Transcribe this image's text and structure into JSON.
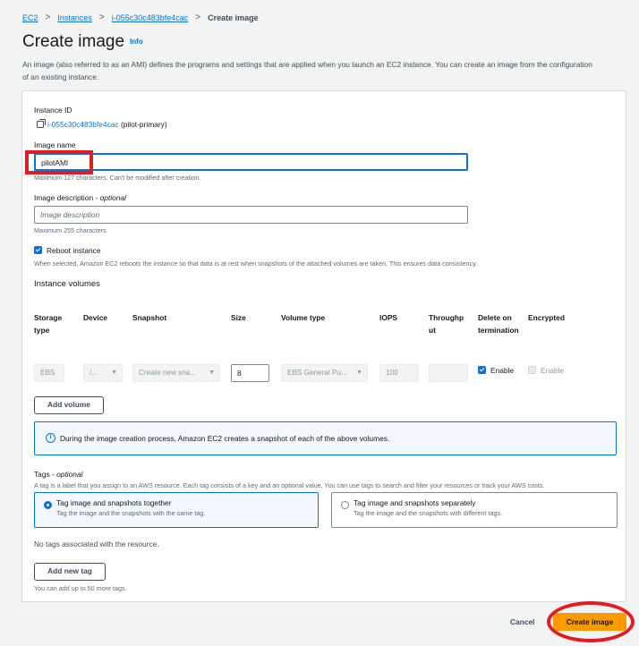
{
  "breadcrumb": {
    "items": [
      "EC2",
      "Instances",
      "i-055c30c483bfe4cac"
    ],
    "current": "Create image",
    "separator": ">"
  },
  "header": {
    "title": "Create image",
    "info_link": "Info",
    "description": "An image (also referred to as an AMI) defines the programs and settings that are applied when you launch an EC2 instance. You can create an image from the configuration of an existing instance."
  },
  "instance": {
    "label": "Instance ID",
    "id": "i-055c30c483bfe4cac",
    "name": "(pilot-primary)"
  },
  "image_name": {
    "label": "Image name",
    "value": "pilotAMI",
    "hint": "Maximum 127 characters. Can't be modified after creation."
  },
  "image_description": {
    "label": "Image description - ",
    "label_optional": "optional",
    "placeholder": "Image description",
    "hint": "Maximum 255 characters"
  },
  "reboot": {
    "label": "Reboot instance",
    "checked": true,
    "hint": "When selected, Amazon EC2 reboots the instance so that data is at rest when snapshots of the attached volumes are taken. This ensures data consistency."
  },
  "volumes": {
    "title": "Instance volumes",
    "headers": {
      "storage_type": "Storage type",
      "device": "Device",
      "snapshot": "Snapshot",
      "size": "Size",
      "volume_type": "Volume type",
      "iops": "IOPS",
      "throughput": "Throughput",
      "delete_on_termination": "Delete on termination",
      "encrypted": "Encrypted"
    },
    "row": {
      "storage_type": "EBS",
      "device": "/...",
      "snapshot": "Create new sna...",
      "size": "8",
      "volume_type": "EBS General Pu...",
      "iops": "100",
      "throughput": "",
      "delete_label": "Enable",
      "encrypted_label": "Enable"
    },
    "add_button": "Add volume",
    "info": "During the image creation process, Amazon EC2 creates a snapshot of each of the above volumes."
  },
  "tags": {
    "title": "Tags - ",
    "title_optional": "optional",
    "description": "A tag is a label that you assign to an AWS resource. Each tag consists of a key and an optional value. You can use tags to search and filter your resources or track your AWS costs.",
    "option_together": {
      "title": "Tag image and snapshots together",
      "desc": "Tag the image and the snapshots with the same tag.",
      "selected": true
    },
    "option_separately": {
      "title": "Tag image and snapshots separately",
      "desc": "Tag the image and the snapshots with different tags.",
      "selected": false
    },
    "empty": "No tags associated with the resource.",
    "add_button": "Add new tag",
    "limit_hint": "You can add up to 50 more tags."
  },
  "footer": {
    "cancel": "Cancel",
    "submit": "Create image"
  },
  "colors": {
    "accent": "#0972d3",
    "primary_button": "#ff9900",
    "annotation": "#e41b23",
    "background": "#f2f3f3"
  }
}
